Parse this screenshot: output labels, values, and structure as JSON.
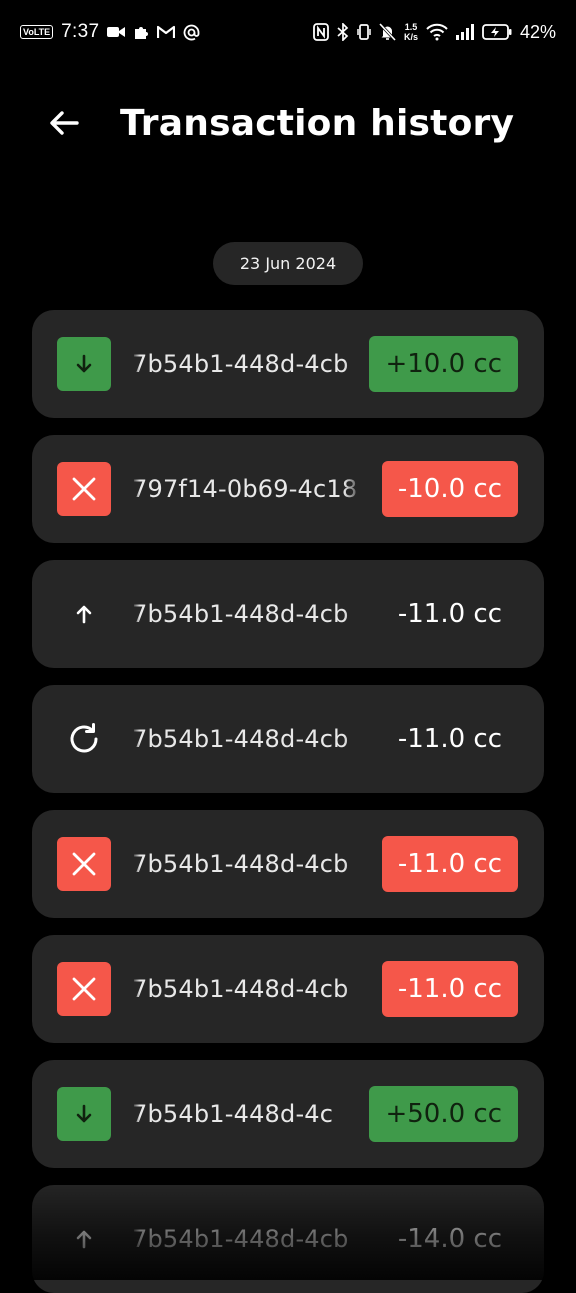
{
  "status_bar": {
    "volte": "VoLTE",
    "time": "7:37",
    "speed_value": "1.5",
    "speed_unit": "K/s",
    "battery": "42%",
    "left_icons": [
      "video-camera-icon",
      "puzzle-icon",
      "gmail-icon",
      "at-sign-icon"
    ],
    "right_icons": [
      "nfc-icon",
      "bluetooth-icon",
      "vibrate-icon",
      "mute-bell-icon",
      "wifi-icon",
      "signal-icon",
      "battery-icon"
    ]
  },
  "header": {
    "title": "Transaction history",
    "back_icon": "arrow-left-icon"
  },
  "date_chip": "23 Jun 2024",
  "transactions": [
    {
      "type": "received",
      "icon": "arrow-down-icon",
      "id": "7b54b1-448d-4cb",
      "amount": "+10.0 cc"
    },
    {
      "type": "failed",
      "icon": "x-icon",
      "id": "797f14-0b69-4c18",
      "amount": "-10.0 cc"
    },
    {
      "type": "sent",
      "icon": "arrow-up-icon",
      "id": "7b54b1-448d-4cb",
      "amount": "-11.0 cc"
    },
    {
      "type": "pending",
      "icon": "refresh-icon",
      "id": "7b54b1-448d-4cb",
      "amount": "-11.0 cc"
    },
    {
      "type": "failed",
      "icon": "x-icon",
      "id": "7b54b1-448d-4cb",
      "amount": "-11.0 cc"
    },
    {
      "type": "failed",
      "icon": "x-icon",
      "id": "7b54b1-448d-4cb",
      "amount": "-11.0 cc"
    },
    {
      "type": "received",
      "icon": "arrow-down-icon",
      "id": "7b54b1-448d-4c",
      "amount": "+50.0 cc"
    },
    {
      "type": "sent",
      "icon": "arrow-up-icon",
      "id": "7b54b1-448d-4cb",
      "amount": "-14.0 cc"
    }
  ],
  "colors": {
    "background": "#000000",
    "card": "#262626",
    "success": "#3f9a4a",
    "danger": "#f5574a",
    "text": "#ffffff"
  }
}
